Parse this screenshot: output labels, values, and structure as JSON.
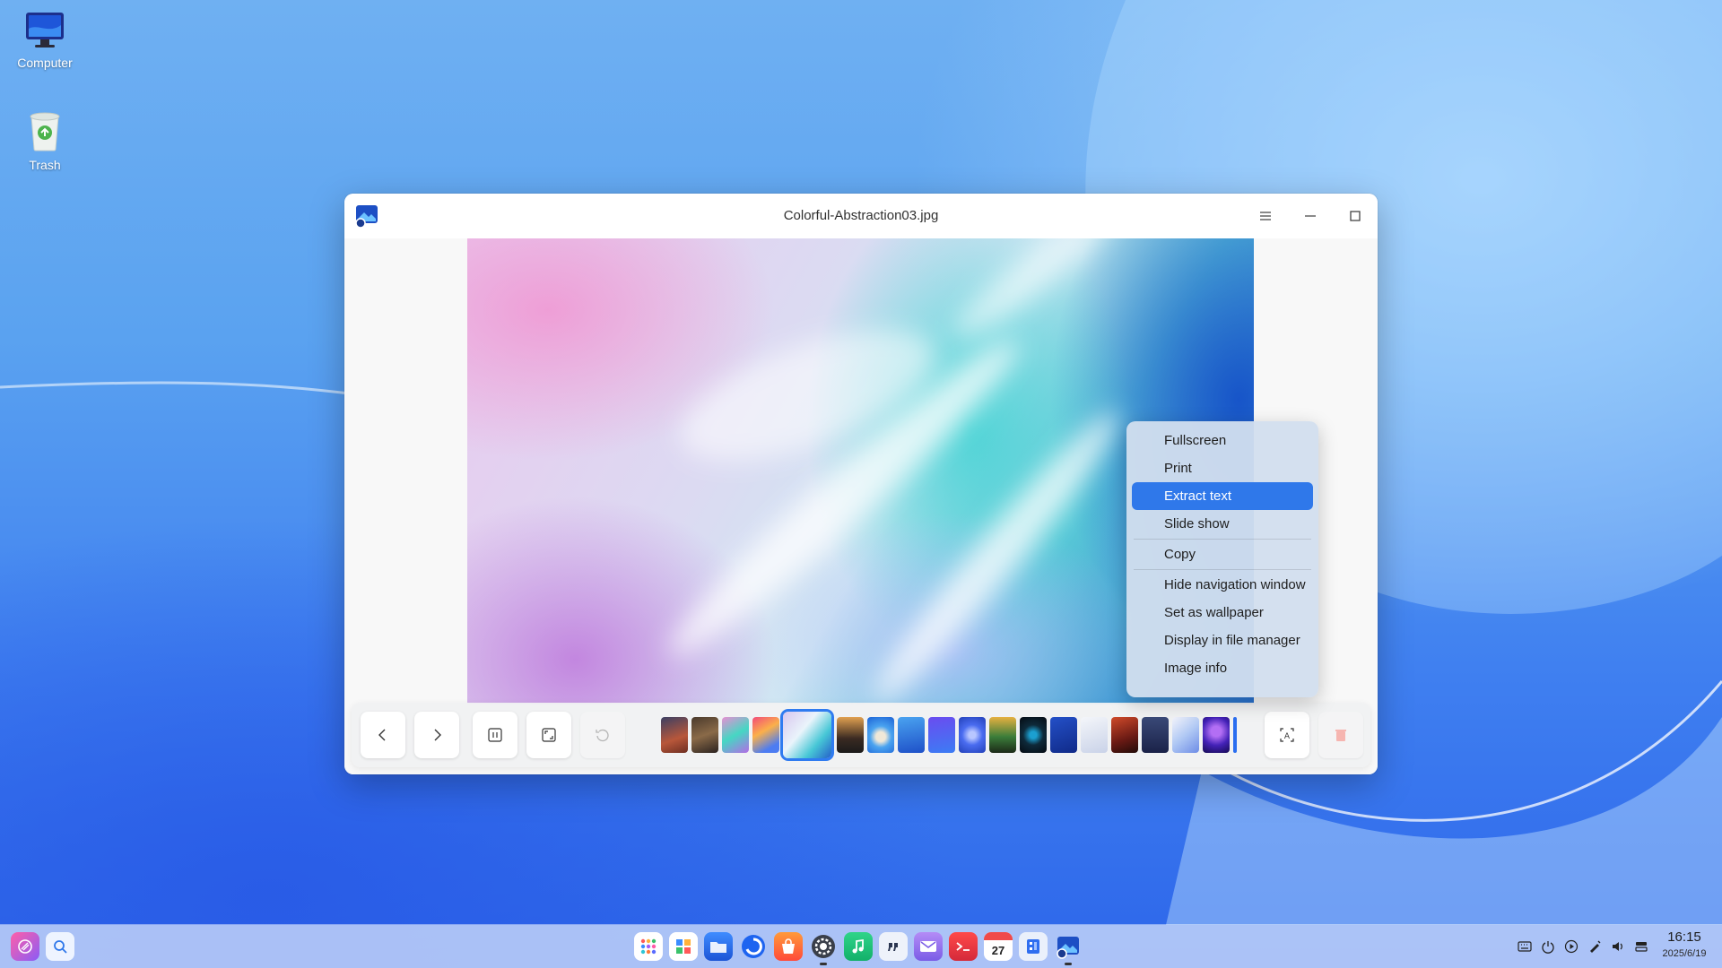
{
  "desktop": {
    "icons": [
      {
        "label": "Computer",
        "icon": "computer-icon"
      },
      {
        "label": "Trash",
        "icon": "trash-icon"
      }
    ]
  },
  "window": {
    "title": "Colorful-Abstraction03.jpg",
    "app_icon": "image-viewer-icon",
    "controls": [
      "menu-icon",
      "minimize-icon",
      "maximize-icon",
      "close-icon"
    ]
  },
  "toolbar": {
    "buttons": [
      "previous-icon",
      "next-icon",
      "original-size-icon",
      "fit-window-icon",
      "rotate-icon",
      "ocr-icon",
      "delete-icon"
    ],
    "thumbnail_count": 20,
    "current_thumbnail_index": 4
  },
  "context_menu": {
    "items": [
      {
        "label": "Fullscreen"
      },
      {
        "label": "Print"
      },
      {
        "label": "Extract text",
        "active": true
      },
      {
        "label": "Slide show"
      },
      {
        "label": "Copy"
      },
      {
        "label": "Hide navigation window"
      },
      {
        "label": "Set as wallpaper"
      },
      {
        "label": "Display in file manager"
      },
      {
        "label": "Image info"
      }
    ]
  },
  "taskbar": {
    "left_apps": [
      "launcher-icon",
      "search-icon"
    ],
    "center_apps": [
      "app-grid-icon",
      "multitask-icon",
      "file-manager-icon",
      "browser-icon",
      "app-store-icon",
      "settings-icon",
      "music-icon",
      "notes-icon",
      "mail-icon",
      "terminal-icon",
      "calendar-icon",
      "document-icon",
      "image-viewer-icon"
    ],
    "calendar_day": "27",
    "tray": [
      "keyboard-icon",
      "power-icon",
      "media-icon",
      "pen-icon",
      "volume-icon",
      "storage-icon"
    ],
    "time": "16:15",
    "date": "2025/6/19"
  },
  "colors": {
    "accent": "#2f78ea",
    "menu_bg": "#d2deee",
    "taskbar_bg": "#cedcfa"
  }
}
